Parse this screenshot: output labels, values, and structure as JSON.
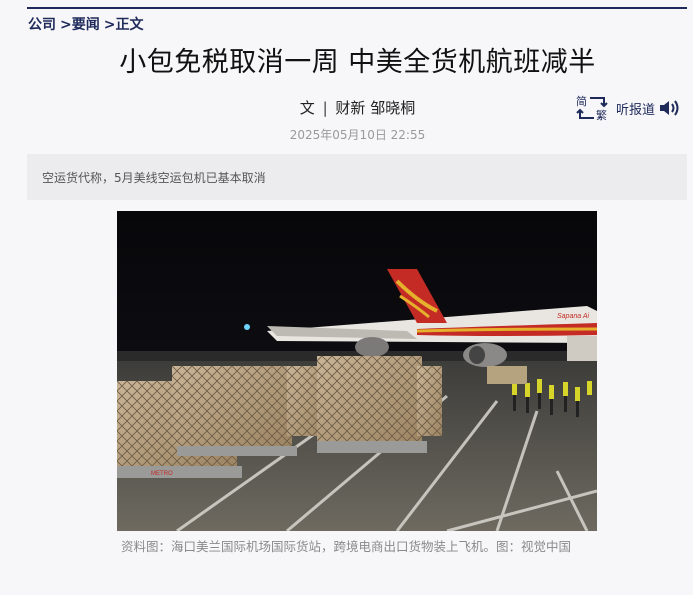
{
  "breadcrumb": {
    "items": [
      "公司",
      ">要闻",
      ">正文"
    ]
  },
  "article": {
    "title": "小包免税取消一周 中美全货机航班减半",
    "byline_prefix": "文",
    "byline_separator": "|",
    "byline_source": "财新",
    "byline_author": "邹晓桐",
    "date": "2025年05月10日 22:55",
    "summary": "空运货代称，5月美线空运包机已基本取消",
    "photo_caption": "资料图：海口美兰国际机场国际货站，跨境电商出口货物装上飞机。图：视觉中国"
  },
  "tools": {
    "trad_top": "简",
    "trad_bottom": "繁",
    "listen_label": "听报道",
    "listen_icon": "speaker-icon",
    "trad_icon": "swap-arrows-icon"
  },
  "photo": {
    "aircraft_livery": "Sapana Ai",
    "cargo_label": "METRO"
  },
  "colors": {
    "accent": "#1e2a5a",
    "summary_bg": "#ececee",
    "caption": "#8a8a8a",
    "date": "#9a9a9a"
  }
}
